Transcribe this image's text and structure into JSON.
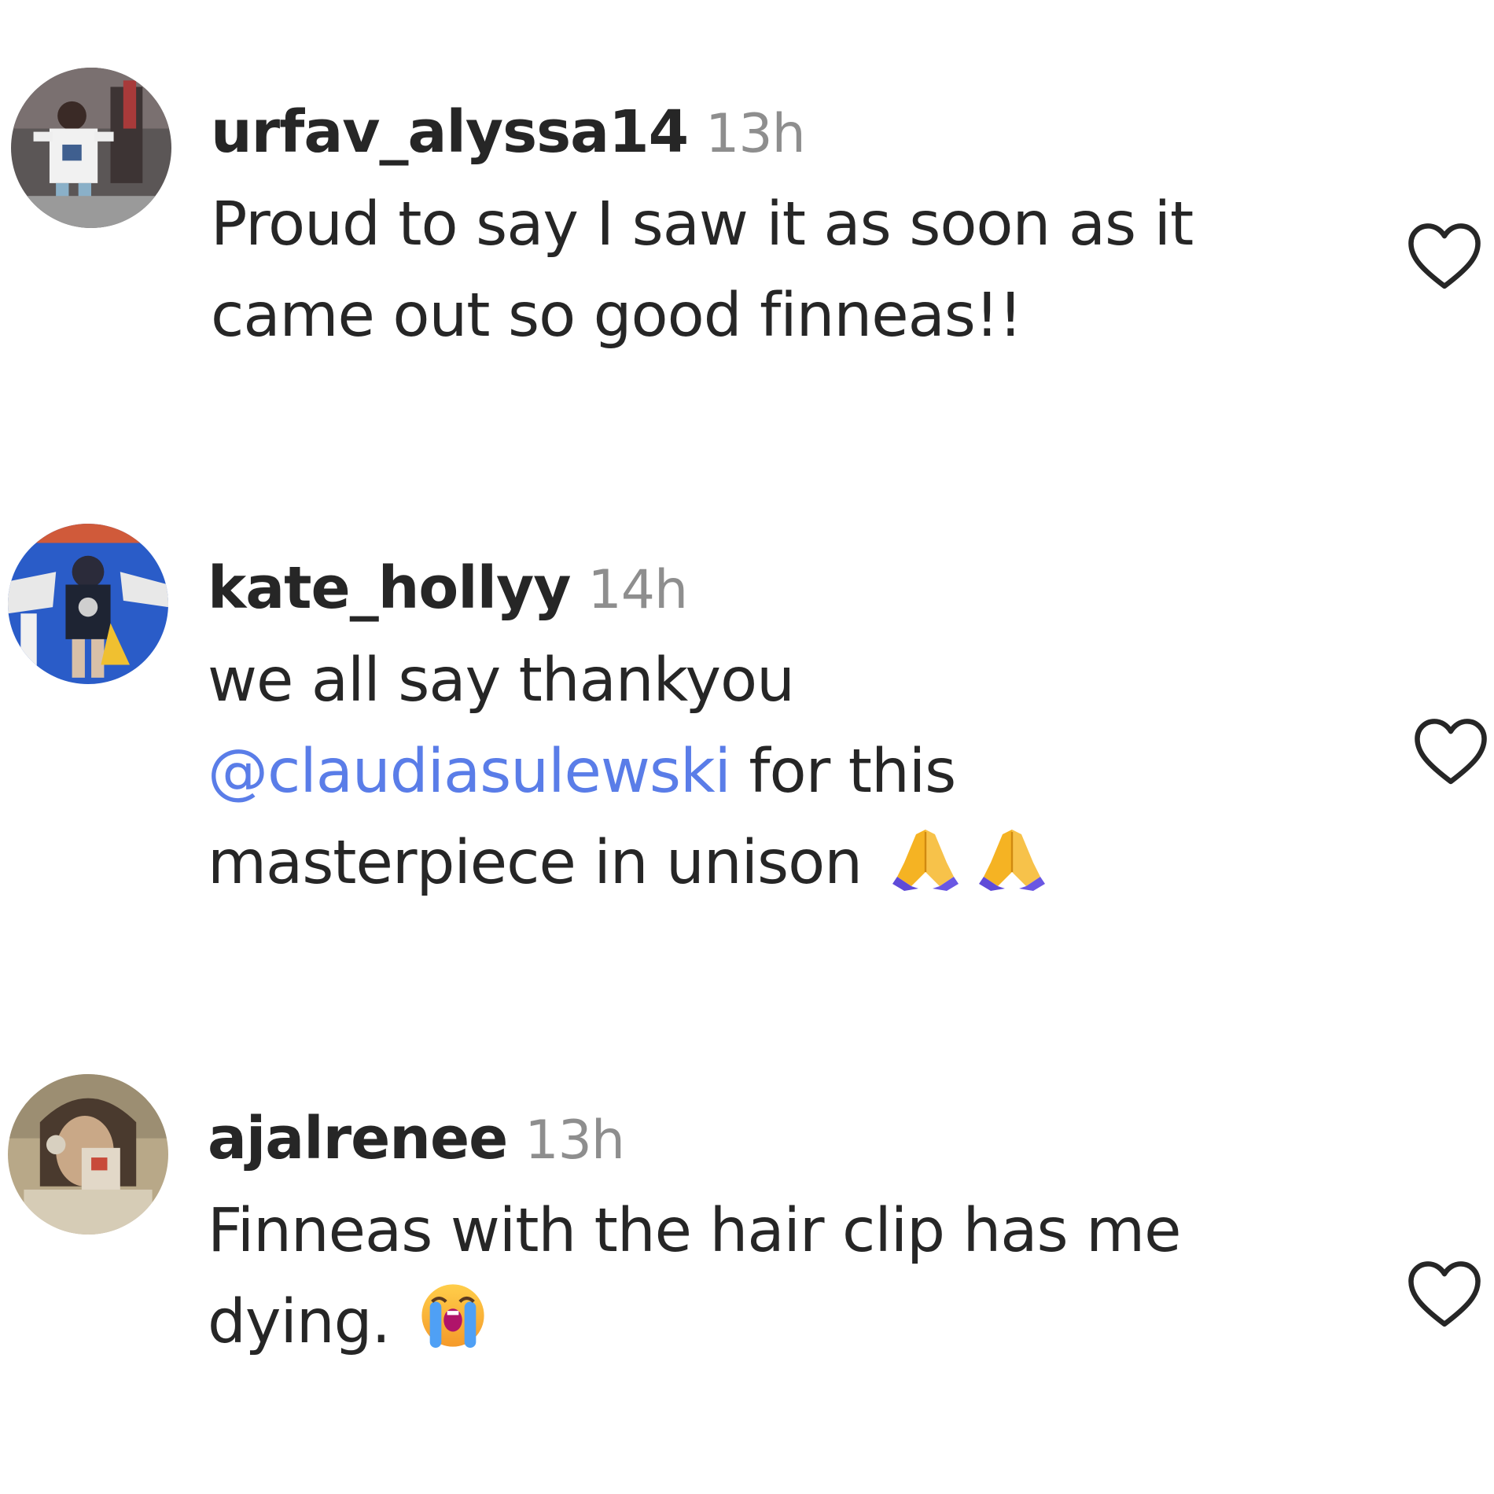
{
  "colors": {
    "text": "#262626",
    "timestamp": "#8e8e8e",
    "mention": "#5a7de8",
    "like_outline": "#262626"
  },
  "comments": [
    {
      "username": "urfav_alyssa14",
      "timestamp": "13h",
      "text_lines": [
        "Proud to say I saw it as soon as it",
        "came out so good finneas!!"
      ],
      "like_icon": "heart-outline-icon"
    },
    {
      "username": "kate_hollyy",
      "timestamp": "14h",
      "text_line_1": "we all say thankyou",
      "mention": "@claudiasulewski",
      "text_after_mention": " for this",
      "text_line_3": "masterpiece in unison",
      "emojis": [
        "folded-hands-emoji",
        "folded-hands-emoji"
      ],
      "like_icon": "heart-outline-icon"
    },
    {
      "username": "ajalrenee",
      "timestamp": "13h",
      "text_line_1": "Finneas with the hair clip has me",
      "text_line_2": "dying.",
      "emojis": [
        "loudly-crying-face-emoji"
      ],
      "like_icon": "heart-outline-icon"
    }
  ]
}
